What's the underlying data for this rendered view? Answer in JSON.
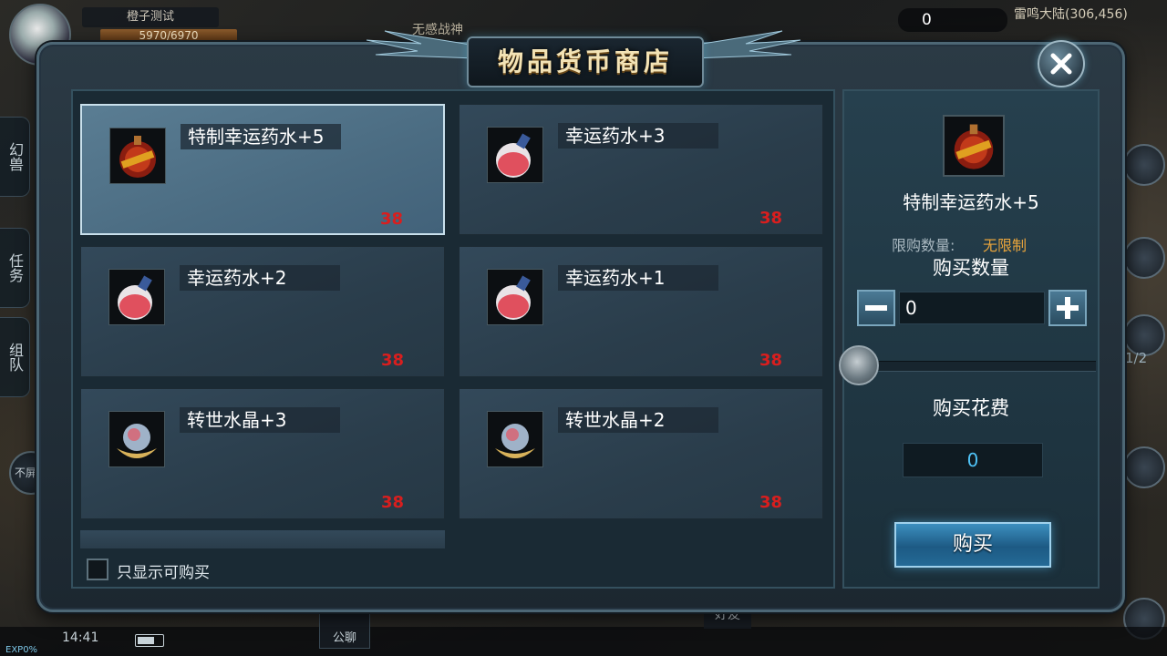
{
  "hud": {
    "player_name": "橙子测试",
    "hp_text": "5970/6970",
    "top_title": "无感战神",
    "gold": "0",
    "location": "雷鸣大陆(306,456)",
    "side_tabs": [
      "幻兽",
      "任务",
      "组队"
    ],
    "shield_toggle": "不屏蔽",
    "page_indicator": "1/2",
    "clock": "14:41",
    "exp": "EXP0%",
    "chat": "公聊",
    "friends": "好友"
  },
  "shop": {
    "title": "物品货币商店",
    "items": [
      {
        "name": "特制幸运药水+5",
        "price": "38",
        "icon": "red-potion-flask-icon",
        "selected": true
      },
      {
        "name": "幸运药水+3",
        "price": "38",
        "icon": "pink-potion-flask-icon",
        "selected": false
      },
      {
        "name": "幸运药水+2",
        "price": "38",
        "icon": "pink-potion-flask-icon",
        "selected": false
      },
      {
        "name": "幸运药水+1",
        "price": "38",
        "icon": "pink-potion-flask-icon",
        "selected": false
      },
      {
        "name": "转世水晶+3",
        "price": "38",
        "icon": "crystal-orb-icon",
        "selected": false
      },
      {
        "name": "转世水晶+2",
        "price": "38",
        "icon": "crystal-orb-icon",
        "selected": false
      }
    ],
    "filter_label": "只显示可购买",
    "detail": {
      "name": "特制幸运药水+5",
      "limit_label": "限购数量:",
      "limit_value": "无限制",
      "quantity_title": "购买数量",
      "quantity": "0",
      "cost_title": "购买花费",
      "cost": "0",
      "buy_label": "购买"
    }
  },
  "colors": {
    "price": "#d91e1e",
    "limit_value": "#e8a43c",
    "cost": "#4fc3f7",
    "accent": "#3c8fbf"
  }
}
